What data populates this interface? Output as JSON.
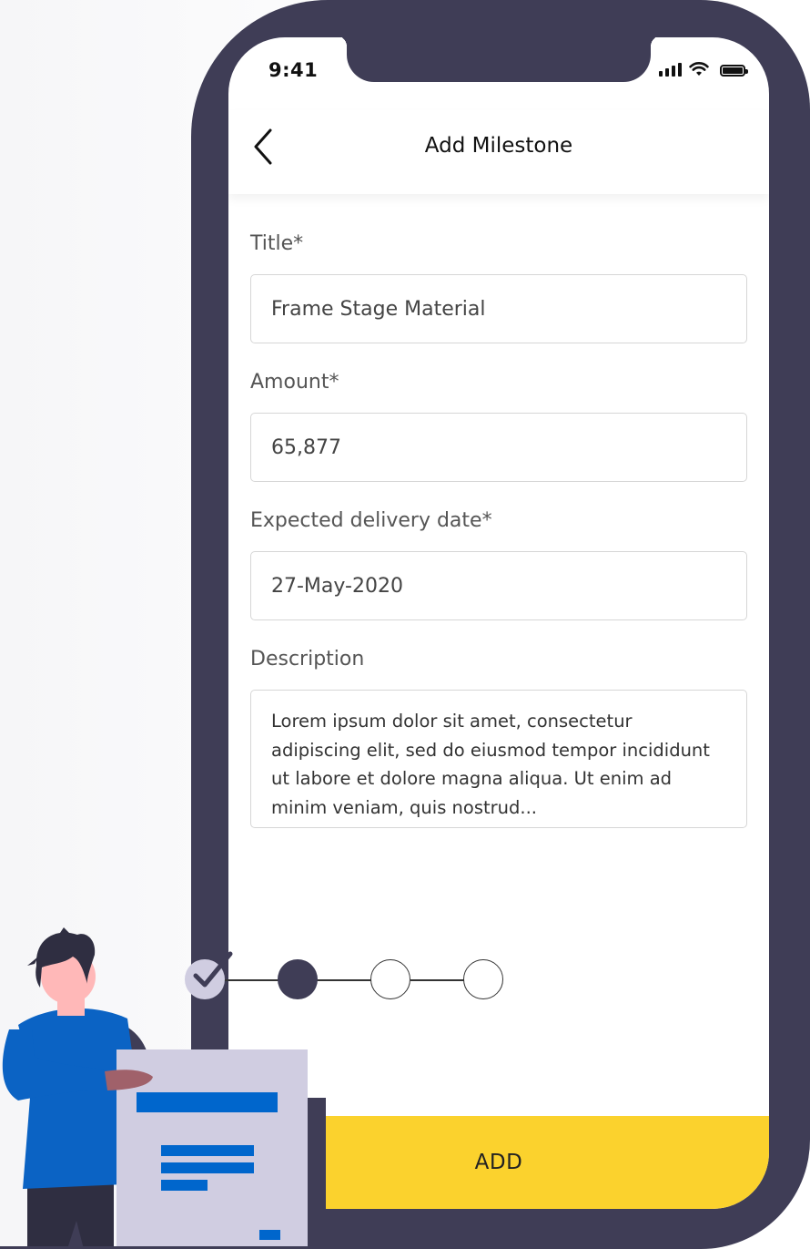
{
  "status_bar": {
    "time": "9:41",
    "signal_icon": "cellular-signal-icon",
    "wifi_icon": "wifi-icon",
    "battery_icon": "battery-icon"
  },
  "header": {
    "title": "Add Milestone",
    "back_icon": "chevron-left-icon"
  },
  "form": {
    "title": {
      "label": "Title*",
      "value": "Frame Stage Material"
    },
    "amount": {
      "label": "Amount*",
      "value": "65,877"
    },
    "delivery_date": {
      "label": "Expected delivery date*",
      "value": "27-May-2020"
    },
    "description": {
      "label": "Description",
      "value": "Lorem ipsum dolor sit amet, consectetur adipiscing elit, sed do eiusmod tempor incididunt ut labore et dolore magna aliqua. Ut enim ad minim veniam, quis nostrud..."
    }
  },
  "stepper": {
    "total_steps": 4,
    "completed_steps": 1,
    "current_step": 2,
    "completed_icon": "check-icon"
  },
  "actions": {
    "add_label": "ADD"
  },
  "colors": {
    "frame": "#3f3d56",
    "accent_yellow": "#fbd22d",
    "illustration_blue": "#0066cc",
    "paper": "#d0cde1",
    "skin": "#ffb8b8"
  }
}
